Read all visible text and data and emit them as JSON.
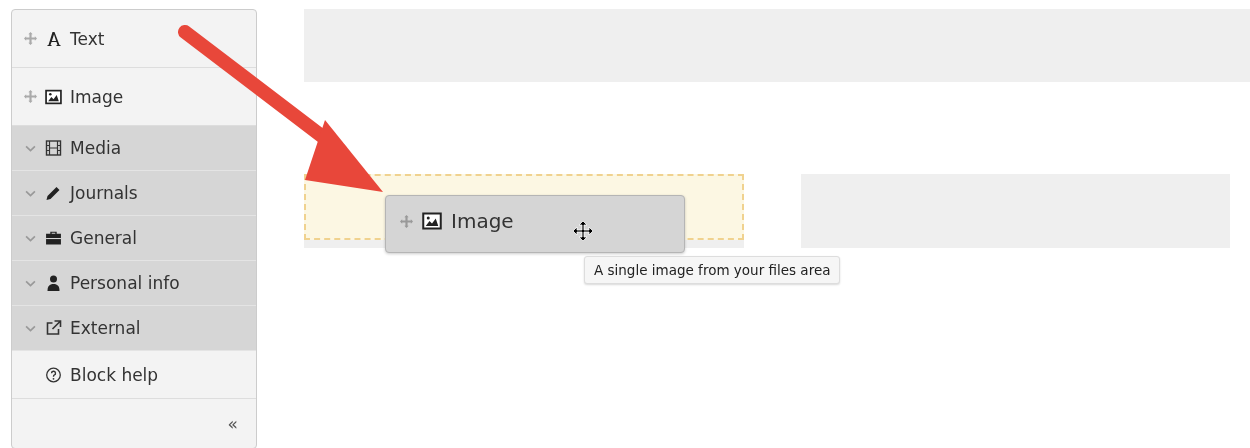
{
  "sidebar": {
    "items": [
      {
        "kind": "block",
        "label": "Text"
      },
      {
        "kind": "block",
        "label": "Image"
      },
      {
        "kind": "category",
        "label": "Media",
        "expanded": false
      },
      {
        "kind": "category",
        "label": "Journals",
        "expanded": false
      },
      {
        "kind": "category",
        "label": "General",
        "expanded": false
      },
      {
        "kind": "category",
        "label": "Personal info",
        "expanded": false
      },
      {
        "kind": "category",
        "label": "External",
        "expanded": false
      },
      {
        "kind": "help",
        "label": "Block help"
      }
    ],
    "collapse": "«"
  },
  "drag": {
    "label": "Image",
    "tooltip": "A single image from your files area"
  }
}
